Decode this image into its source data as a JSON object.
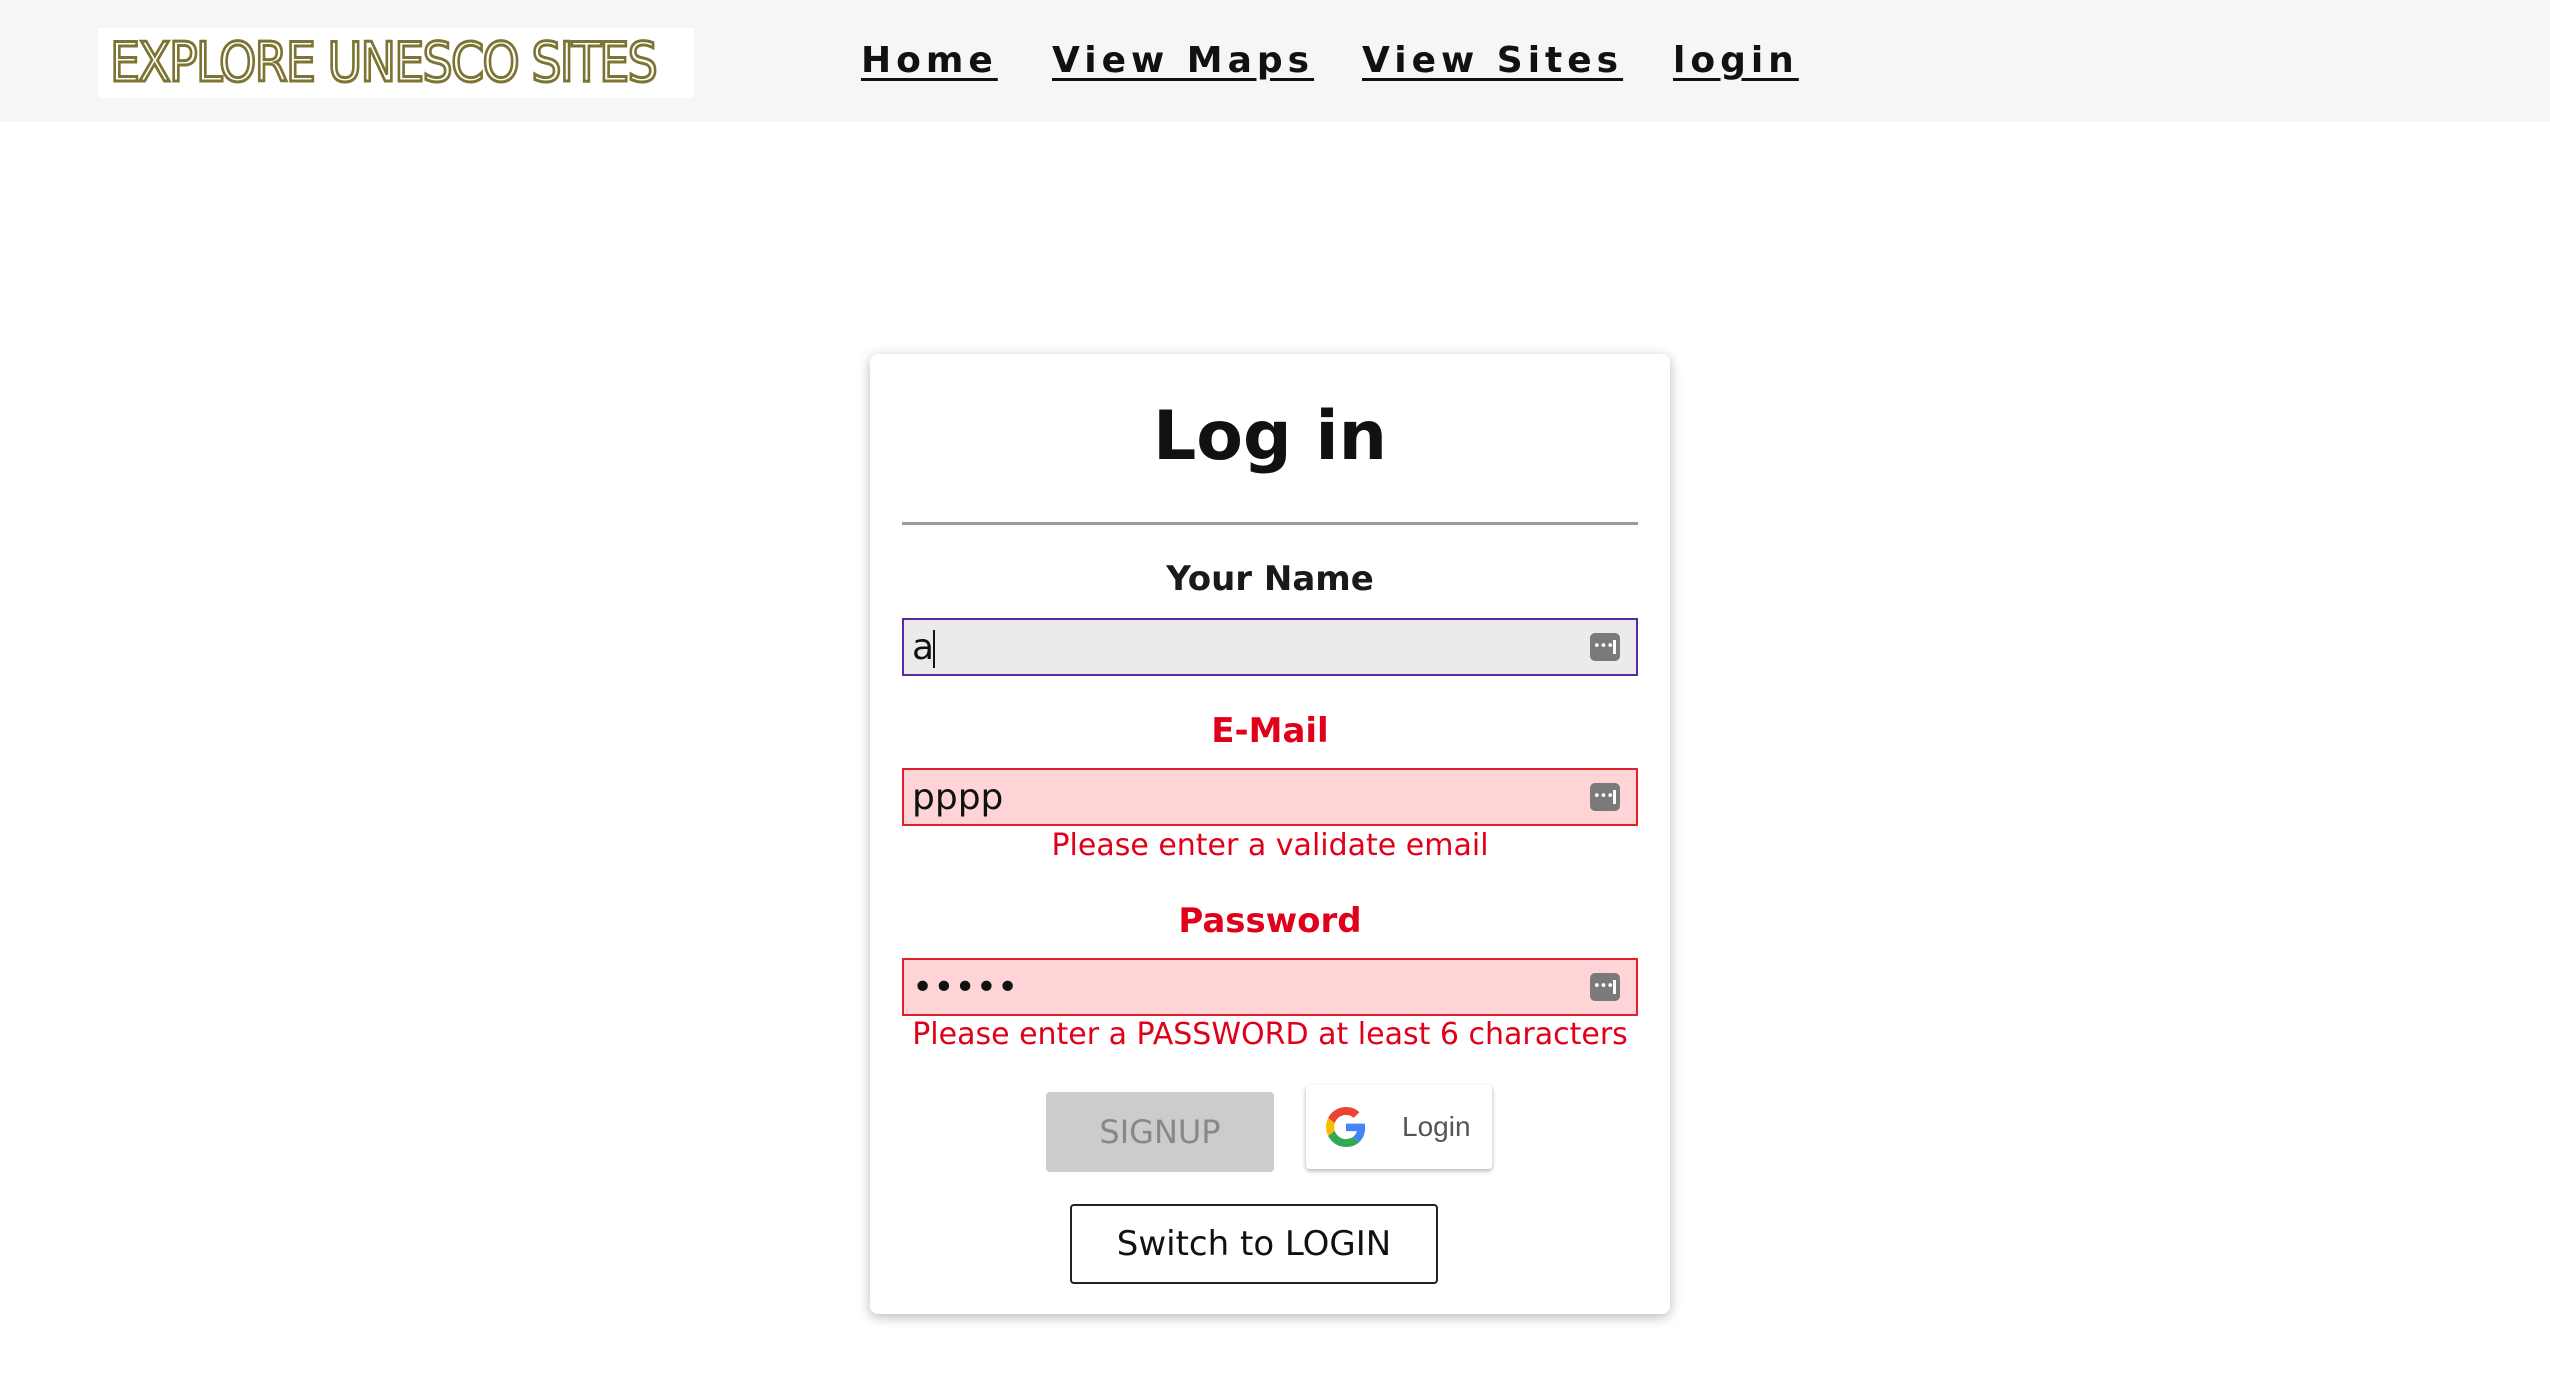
{
  "brand": {
    "logo_text": "EXPLORE UNESCO SITES"
  },
  "nav": {
    "items": [
      {
        "label": "Home"
      },
      {
        "label": "View Maps"
      },
      {
        "label": "View Sites"
      },
      {
        "label": "login"
      }
    ]
  },
  "form": {
    "title": "Log in",
    "name": {
      "label": "Your Name",
      "value": "a"
    },
    "email": {
      "label": "E-Mail",
      "value": "pppp",
      "error": "Please enter a validate email"
    },
    "password": {
      "label": "Password",
      "value": "•••••",
      "error": "Please enter a PASSWORD at least 6 characters"
    },
    "signup_label": "SIGNUP",
    "google_label": "Login",
    "switch_label": "Switch to LOGIN"
  },
  "colors": {
    "nav_background": "#f6f6f6",
    "logo_color": "#7c7433",
    "error_text": "#e0001a",
    "error_field_background": "#ffd4d7",
    "error_field_border": "#e1202e",
    "focused_field_border": "#5a2aa0",
    "disabled_button": "#cccccc"
  },
  "icons": {
    "password_manager": "password-key-icon",
    "google": "google-g-icon"
  }
}
